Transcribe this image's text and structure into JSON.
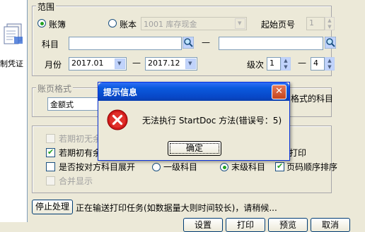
{
  "desktop": {
    "icon_label": "制凭证",
    "icon_name": "document-icon"
  },
  "range_group": {
    "title": "范围",
    "radio_ledger": "账簿",
    "radio_account": "账本",
    "account_value": "1001 库存现金",
    "start_page_label": "起始页号",
    "start_page_value": "1",
    "subject_label": "科目",
    "subject_from": "",
    "subject_to": "",
    "dash": "—",
    "month_label": "月份",
    "month_from": "2017.01",
    "month_to": "2017.12",
    "level_label": "级次",
    "level_from": "1",
    "level_to": "4"
  },
  "format_group": {
    "title": "账页格式",
    "format_value": "金额式",
    "subject_note": "格式的科目"
  },
  "options": {
    "opt1": "若期初无余",
    "opt2": "若期初有余",
    "opt2_checked": true,
    "opt3": "是否按对方科目展开",
    "opt4": "合并显示",
    "print_label": "打印",
    "radio_level1": "一级科目",
    "radio_last": "末级科目",
    "page_order": "页码顺序排序",
    "page_order_checked": true
  },
  "status": {
    "stop_button": "停止处理",
    "message": "正在输送打印任务(如数据量大则时间较长)，请稍候..."
  },
  "bottom_buttons": [
    "设置",
    "打印",
    "预览",
    "取消"
  ],
  "dialog": {
    "title": "提示信息",
    "close_glyph": "✕",
    "message": "无法执行 StartDoc 方法(错误号：5)",
    "ok": "确定",
    "icon": "error-icon"
  },
  "colors": {
    "titlebar": "#0a5ade",
    "error": "#d11a1a",
    "window_bg": "#ece9d8"
  }
}
